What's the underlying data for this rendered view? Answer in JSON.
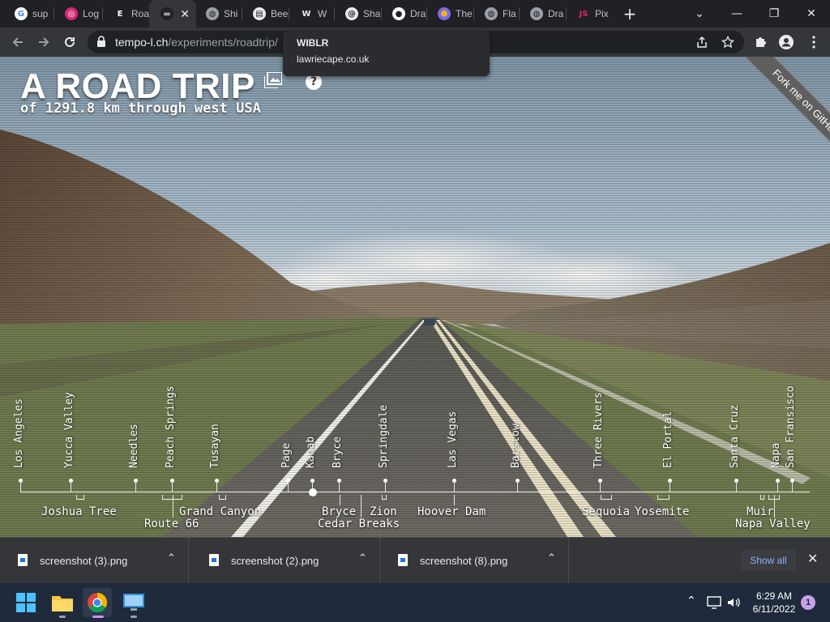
{
  "browser": {
    "tabs": [
      {
        "label": "sup",
        "icon": "google-icon"
      },
      {
        "label": "Log",
        "icon": "instagram-icon"
      },
      {
        "label": "Roa",
        "icon": "letter-e-icon"
      },
      {
        "label": "",
        "icon": "car-icon",
        "active": true
      },
      {
        "label": "Shi",
        "icon": "globe-icon"
      },
      {
        "label": "Bee",
        "icon": "document-icon"
      },
      {
        "label": "W",
        "icon": "letter-w-icon"
      },
      {
        "label": "Sha",
        "icon": "swirl-icon"
      },
      {
        "label": "Dra",
        "icon": "github-icon"
      },
      {
        "label": "The",
        "icon": "hexagon-icon"
      },
      {
        "label": "Fla",
        "icon": "globe-icon"
      },
      {
        "label": "Dra",
        "icon": "globe-icon"
      },
      {
        "label": "Pix",
        "icon": "js-icon"
      }
    ],
    "new_tab_symbol": "+",
    "window_controls": {
      "tab_search": "⌄",
      "minimize": "—",
      "restore": "❐",
      "close": "✕"
    },
    "active_tab_close": "✕",
    "url": {
      "host": "tempo-l.ch",
      "path": "/experiments/roadtrip/"
    },
    "hover_card": {
      "title": "WIBLR",
      "url": "lawriecape.co.uk"
    }
  },
  "page": {
    "title": "A ROAD TRIP",
    "subtitle": "of 1291.8 km through west USA",
    "help_symbol": "?",
    "ribbon": "Fork me on GitHub",
    "stops": [
      {
        "name": "Los Angeles"
      },
      {
        "name": "Yucca Valley"
      },
      {
        "name": "Needles"
      },
      {
        "name": "Peach Springs"
      },
      {
        "name": "Tusayan"
      },
      {
        "name": "Page"
      },
      {
        "name": "Kanab"
      },
      {
        "name": "Bryce"
      },
      {
        "name": "Springdale"
      },
      {
        "name": "Las Vegas"
      },
      {
        "name": "Barstow"
      },
      {
        "name": "Three Rivers"
      },
      {
        "name": "El Portal"
      },
      {
        "name": "Santa Cruz"
      },
      {
        "name": "Napa"
      },
      {
        "name": "San Fransisco"
      }
    ],
    "regions": [
      {
        "name": "Joshua Tree"
      },
      {
        "name": "Route 66"
      },
      {
        "name": "Grand Canyon"
      },
      {
        "name": "Bryce"
      },
      {
        "name": "Zion"
      },
      {
        "name": "Cedar Breaks"
      },
      {
        "name": "Hoover Dam"
      },
      {
        "name": "Sequoia"
      },
      {
        "name": "Yosemite"
      },
      {
        "name": "Muir"
      },
      {
        "name": "Napa Valley"
      }
    ]
  },
  "downloads": {
    "items": [
      {
        "name": "screenshot (3).png"
      },
      {
        "name": "screenshot (2).png"
      },
      {
        "name": "screenshot (8).png"
      }
    ],
    "chevron": "⌃",
    "show_all": "Show all",
    "close": "✕"
  },
  "taskbar": {
    "apps": [
      {
        "icon": "windows-start-icon"
      },
      {
        "icon": "file-explorer-icon"
      },
      {
        "icon": "chrome-icon",
        "active": true
      },
      {
        "icon": "control-panel-icon"
      }
    ],
    "time": "6:29 AM",
    "date": "6/11/2022",
    "notification_count": "1",
    "tray_chevron": "⌃"
  }
}
